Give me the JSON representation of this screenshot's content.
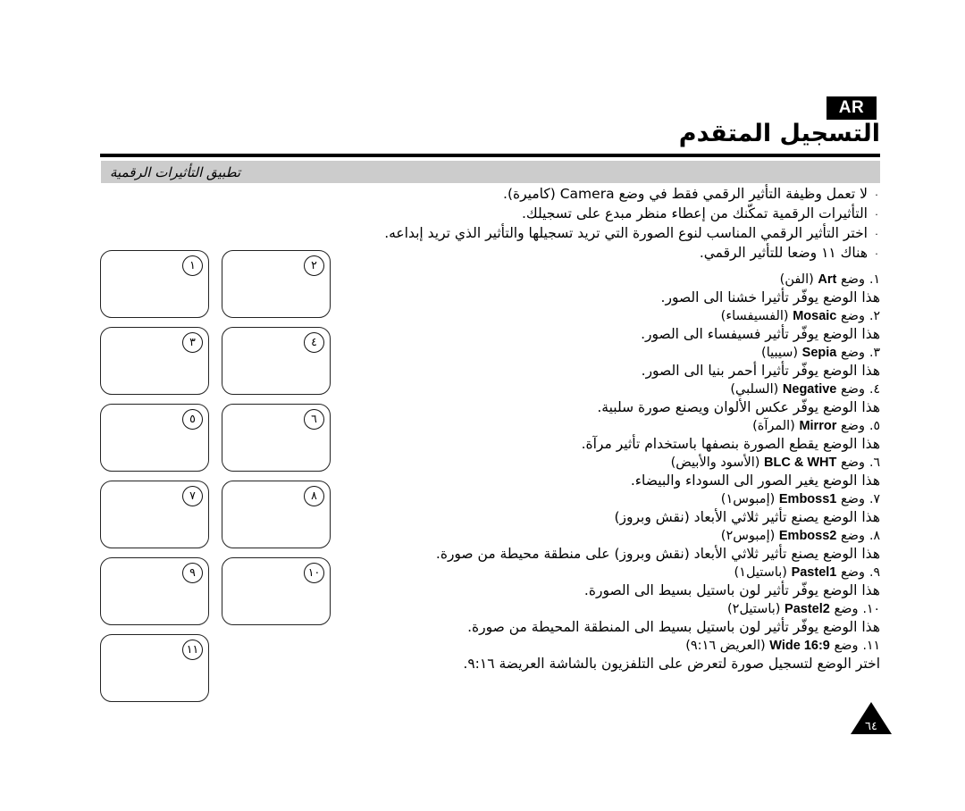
{
  "header": {
    "language_badge": "AR",
    "title": "التسجيل المتقدم",
    "section_label": "تطبيق التأثيرات الرقمية"
  },
  "intro": {
    "bullet_glyph": "·",
    "items": [
      "لا تعمل وظيفة التأثير الرقمي فقط في وضع Camera (كاميرة).",
      "التأثيرات الرقمية تمكّنك من إعطاء منظر مبدع على تسجيلك.",
      "اختر التأثير الرقمي المناسب لنوع الصورة التي تريد تسجيلها والتأثير الذي تريد إبداعه.",
      "هناك ١١ وضعا للتأثير الرقمي."
    ]
  },
  "modes": [
    {
      "number": "١.",
      "name_ar_prefix": "وضع",
      "name_en": "Art",
      "name_ar_suffix": "(الفن)",
      "description": "هذا الوضع يوفّر تأثيرا خشنا الى الصور."
    },
    {
      "number": "٢.",
      "name_ar_prefix": "وضع",
      "name_en": "Mosaic",
      "name_ar_suffix": "(الفسيفساء)",
      "description": "هذا الوضع يوفّر تأثير فسيفساء الى الصور."
    },
    {
      "number": "٣.",
      "name_ar_prefix": "وضع",
      "name_en": "Sepia",
      "name_ar_suffix": "(سيبيا)",
      "description": "هذا الوضع يوفّر تأثيرا أحمر بنيا الى الصور."
    },
    {
      "number": "٤.",
      "name_ar_prefix": "وضع",
      "name_en": "Negative",
      "name_ar_suffix": "(السلبي)",
      "description": "هذا الوضع يوفّر عكس الألوان ويصنع صورة سلبية."
    },
    {
      "number": "٥.",
      "name_ar_prefix": "وضع",
      "name_en": "Mirror",
      "name_ar_suffix": "(المرآة)",
      "description": "هذا الوضع يقطع الصورة بنصفها باستخدام تأثير مرآة."
    },
    {
      "number": "٦.",
      "name_ar_prefix": "وضع",
      "name_en": "BLC & WHT",
      "name_ar_suffix": "(الأسود والأبيض)",
      "description": "هذا الوضع يغير الصور الى السوداء والبيضاء."
    },
    {
      "number": "٧.",
      "name_ar_prefix": "وضع",
      "name_en": "Emboss1",
      "name_ar_suffix": "(إمبوس١)",
      "description": "هذا الوضع يصنع تأثير ثلاثي الأبعاد (نقش وبروز)"
    },
    {
      "number": "٨.",
      "name_ar_prefix": "وضع",
      "name_en": "Emboss2",
      "name_ar_suffix": "(إمبوس٢)",
      "description": "هذا الوضع يصنع تأثير ثلاثي الأبعاد (نقش وبروز) على منطقة محيطة من صورة."
    },
    {
      "number": "٩.",
      "name_ar_prefix": "وضع",
      "name_en": "Pastel1",
      "name_ar_suffix": "(باستيل١)",
      "description": "هذا الوضع يوفّر تأثير لون باستيل بسيط الى الصورة."
    },
    {
      "number": "١٠.",
      "name_ar_prefix": "وضع",
      "name_en": "Pastel2",
      "name_ar_suffix": "(باستيل٢)",
      "description": "هذا الوضع يوفّر تأثير لون باستيل بسيط الى المنطقة المحيطة من صورة."
    },
    {
      "number": "١١.",
      "name_ar_prefix": "وضع",
      "name_en": "16:9 Wide",
      "name_ar_suffix": "(العريض ٩:١٦)",
      "description": "اختر الوضع لتسجيل صورة لتعرض على التلفزيون بالشاشة العريضة ٩:١٦."
    }
  ],
  "thumbnails": {
    "rows": [
      [
        "١",
        "٢"
      ],
      [
        "٣",
        "٤"
      ],
      [
        "٥",
        "٦"
      ],
      [
        "٧",
        "٨"
      ],
      [
        "٩",
        "١٠"
      ],
      [
        "١١"
      ]
    ]
  },
  "footer": {
    "page_number": "٦٤"
  }
}
